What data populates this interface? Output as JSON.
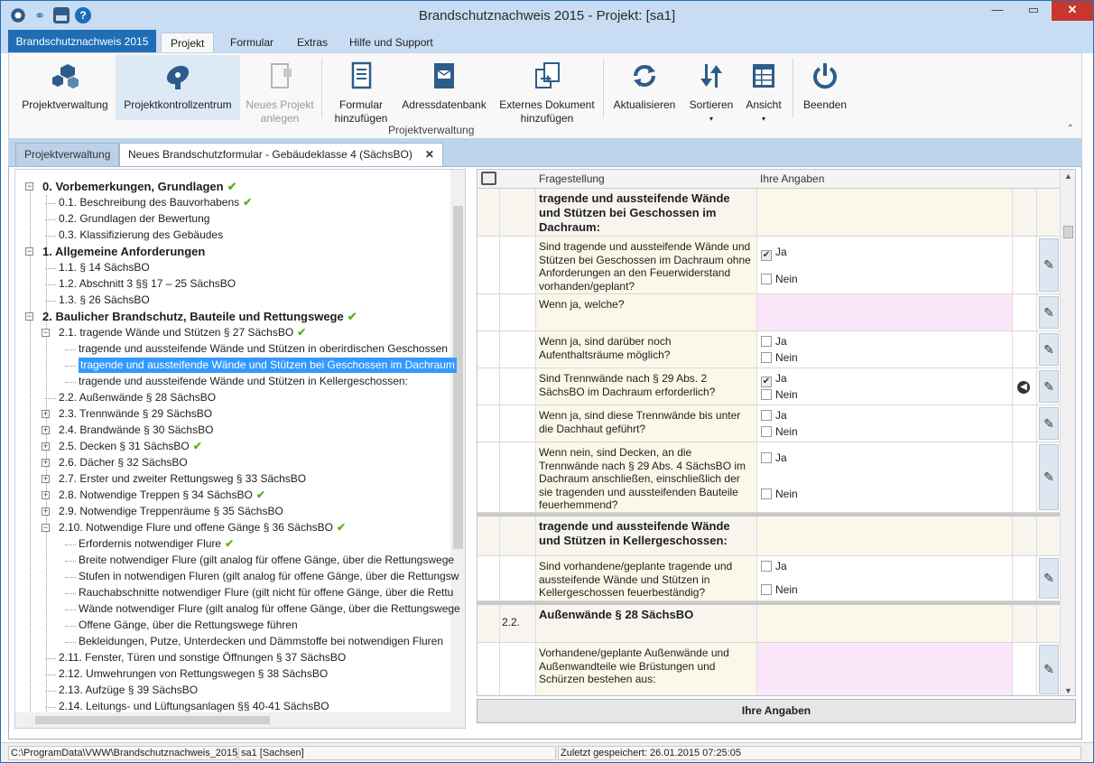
{
  "window": {
    "title": "Brandschutznachweis 2015 - Projekt: [sa1]"
  },
  "file_tab": "Brandschutznachweis 2015",
  "ribbon_tabs": [
    "Projekt",
    "Formular",
    "Extras",
    "Hilfe und Support"
  ],
  "ribbon": {
    "buttons": [
      {
        "label1": "Projektverwaltung",
        "label2": ""
      },
      {
        "label1": "Projektkontrollzentrum",
        "label2": ""
      },
      {
        "label1": "Neues Projekt",
        "label2": "anlegen"
      },
      {
        "label1": "Formular",
        "label2": "hinzufügen"
      },
      {
        "label1": "Adressdatenbank",
        "label2": ""
      },
      {
        "label1": "Externes Dokument",
        "label2": "hinzufügen"
      },
      {
        "label1": "Aktualisieren",
        "label2": ""
      },
      {
        "label1": "Sortieren",
        "label2": "▾"
      },
      {
        "label1": "Ansicht",
        "label2": "▾"
      },
      {
        "label1": "Beenden",
        "label2": ""
      }
    ],
    "group_label": "Projektverwaltung"
  },
  "doc_tabs": {
    "inactive": "Projektverwaltung",
    "active": "Neues Brandschutzformular - Gebäudeklasse 4 (SächsBO)",
    "close": "✕"
  },
  "tree": [
    {
      "text": "0. Vorbemerkungen, Grundlagen",
      "check": "✔"
    },
    {
      "text": "0.1. Beschreibung des Bauvorhabens",
      "check": "✔"
    },
    {
      "text": "0.2. Grundlagen der Bewertung",
      "check": ""
    },
    {
      "text": "0.3. Klassifizierung des Gebäudes",
      "check": ""
    },
    {
      "text": "1. Allgemeine Anforderungen",
      "check": ""
    },
    {
      "text": "1.1. § 14 SächsBO",
      "check": ""
    },
    {
      "text": "1.2. Abschnitt 3 §§ 17 – 25 SächsBO",
      "check": ""
    },
    {
      "text": "1.3. § 26 SächsBO",
      "check": ""
    },
    {
      "text": "2. Baulicher Brandschutz, Bauteile und Rettungswege",
      "check": "✔"
    },
    {
      "text": "2.1. tragende Wände und Stützen § 27 SächsBO",
      "check": "✔"
    },
    {
      "text": "tragende und aussteifende Wände und Stützen in oberirdischen Geschossen",
      "check": ""
    },
    {
      "text": "tragende und aussteifende Wände und Stützen bei Geschossen im Dachraum",
      "check": ""
    },
    {
      "text": "tragende und aussteifende Wände und Stützen in Kellergeschossen:",
      "check": ""
    },
    {
      "text": "2.2. Außenwände § 28 SächsBO",
      "check": ""
    },
    {
      "text": "2.3. Trennwände § 29 SächsBO",
      "check": ""
    },
    {
      "text": "2.4. Brandwände § 30 SächsBO",
      "check": ""
    },
    {
      "text": "2.5. Decken § 31 SächsBO",
      "check": "✔"
    },
    {
      "text": "2.6. Dächer § 32 SächsBO",
      "check": ""
    },
    {
      "text": "2.7. Erster und zweiter Rettungsweg § 33 SächsBO",
      "check": ""
    },
    {
      "text": "2.8. Notwendige Treppen § 34 SächsBO",
      "check": "✔"
    },
    {
      "text": "2.9. Notwendige Treppenräume § 35 SächsBO",
      "check": ""
    },
    {
      "text": "2.10. Notwendige Flure und offene Gänge § 36 SächsBO",
      "check": "✔"
    },
    {
      "text": "Erfordernis notwendiger Flure",
      "check": "✔"
    },
    {
      "text": "Breite notwendiger Flure (gilt analog für offene Gänge, über die Rettungswege",
      "check": ""
    },
    {
      "text": "Stufen in notwendigen Fluren (gilt analog für offene Gänge, über die Rettungsw",
      "check": ""
    },
    {
      "text": "Rauchabschnitte notwendiger Flure (gilt nicht für offene Gänge, über die Rettu",
      "check": ""
    },
    {
      "text": "Wände notwendiger Flure (gilt analog für offene Gänge, über die Rettungswege",
      "check": ""
    },
    {
      "text": "Offene Gänge, über die Rettungswege führen",
      "check": ""
    },
    {
      "text": "Bekleidungen, Putze, Unterdecken und Dämmstoffe bei notwendigen Fluren",
      "check": ""
    },
    {
      "text": "2.11. Fenster, Türen und sonstige Öffnungen § 37 SächsBO",
      "check": ""
    },
    {
      "text": "2.12. Umwehrungen von Rettungswegen § 38 SächsBO",
      "check": ""
    },
    {
      "text": "2.13. Aufzüge § 39 SächsBO",
      "check": ""
    },
    {
      "text": "2.14. Leitungs- und Lüftungsanlagen §§ 40-41 SächsBO",
      "check": ""
    }
  ],
  "grid": {
    "headers": {
      "question": "Fragestellung",
      "answers": "Ihre Angaben"
    },
    "rows": [
      {
        "num": "",
        "text": "tragende und aussteifende Wände und Stützen bei Geschossen im Dachraum:"
      },
      {
        "num": "",
        "text": "Sind tragende und aussteifende Wände und Stützen bei Geschossen im Dachraum ohne Anforderungen an den Feuerwiderstand vorhanden/geplant?"
      },
      {
        "num": "",
        "text": "Wenn ja, welche?"
      },
      {
        "num": "",
        "text": "Wenn ja, sind darüber noch Aufenthaltsräume möglich?"
      },
      {
        "num": "",
        "text": "Sind Trennwände nach § 29 Abs. 2 SächsBO im Dachraum erforderlich?"
      },
      {
        "num": "",
        "text": "Wenn ja, sind diese Trennwände bis unter die Dachhaut geführt?"
      },
      {
        "num": "",
        "text": "Wenn nein, sind Decken, an die Trennwände nach § 29 Abs. 4 SächsBO im Dachraum anschließen, einschließlich der sie tragenden und aussteifenden Bauteile feuerhemmend?"
      },
      {
        "num": "",
        "text": "tragende und aussteifende Wände und Stützen in Kellergeschossen:"
      },
      {
        "num": "",
        "text": "Sind vorhandene/geplante tragende und aussteifende Wände und Stützen in Kellergeschossen feuerbeständig?"
      },
      {
        "num": "2.2.",
        "text": "Außenwände § 28 SächsBO"
      },
      {
        "num": "",
        "text": "Vorhandene/geplante Außenwände und Außenwandteile wie Brüstungen und Schürzen bestehen aus:"
      }
    ],
    "ja": "Ja",
    "nein": "Nein"
  },
  "answers_button": "Ihre Angaben",
  "status": {
    "path": "C:\\ProgramData\\VWW\\Brandschutznachweis_2015_",
    "project": "sa1 [Sachsen]",
    "saved": "Zuletzt gespeichert: 26.01.2015 07:25:05"
  },
  "colors": {
    "accent": "#1f6eb5",
    "highlight": "#3399ff",
    "check": "#5cb31f",
    "pink_cell": "#fbe6fa"
  }
}
